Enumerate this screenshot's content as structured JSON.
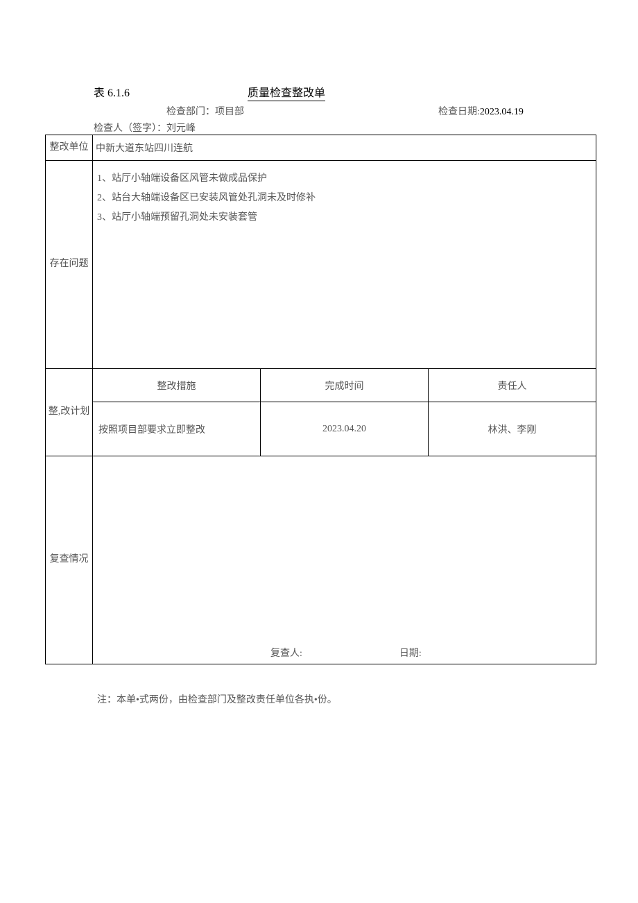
{
  "header": {
    "form_number": "表 6.1.6",
    "title": "质量检查整改单",
    "dept_label": "检查部门：",
    "dept_value": "项目部",
    "date_label": "检查日期:",
    "date_value": "2023.04.19",
    "inspector_label": "检查人（签字）：",
    "inspector_value": "刘元峰"
  },
  "unit": {
    "label": "整改单位",
    "value": "中新大道东站四川连航"
  },
  "issues": {
    "label": "存在问题",
    "items": [
      "1、站厅小轴端设备区风管未做成品保护",
      "2、站台大轴端设备区已安装风管处孔洞未及时修补",
      "3、站厅小轴端预留孔洞处未安装套管"
    ]
  },
  "plan": {
    "label": "整,改计划",
    "headers": {
      "measure": "整改措施",
      "time": "完成时间",
      "person": "责任人"
    },
    "row": {
      "measure": "按照项目部要求立即整改",
      "time": "2023.04.20",
      "person": "林洪、李刚"
    }
  },
  "review": {
    "label": "复查情况",
    "person_label": "复查人:",
    "date_label": "日期:"
  },
  "footnote": "注：本单•式两份，由检查部门及整改责任单位各执•份。"
}
